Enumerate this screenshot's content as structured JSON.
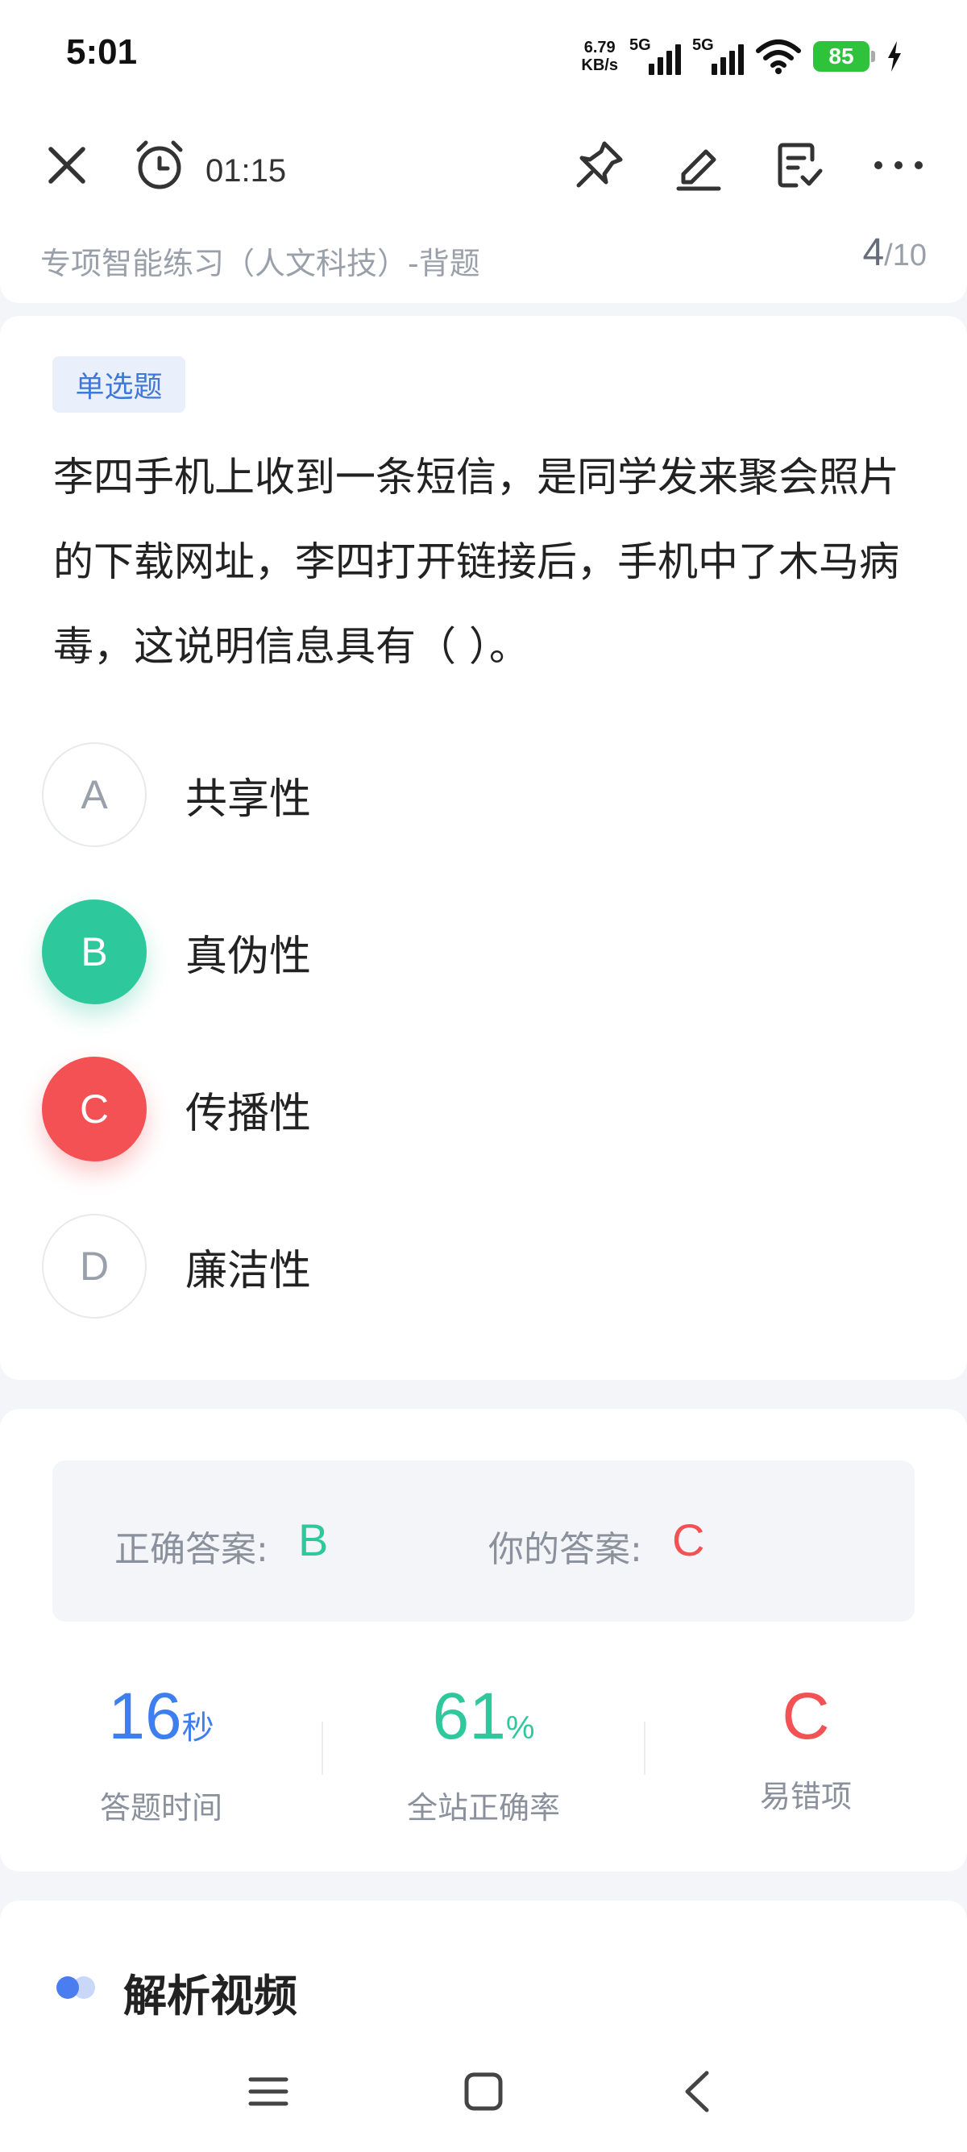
{
  "status_bar": {
    "time": "5:01",
    "net_speed_value": "6.79",
    "net_speed_unit": "KB/s",
    "signal1_label": "5G",
    "signal2_label": "5G",
    "battery": "85"
  },
  "toolbar": {
    "timer": "01:15",
    "subtitle": "专项智能练习（人文科技）-背题",
    "progress_current": "4",
    "progress_total": "/10"
  },
  "question": {
    "type": "单选题",
    "text": "李四手机上收到一条短信，是同学发来聚会照片的下载网址，李四打开链接后，手机中了木马病毒，这说明信息具有（    ）。",
    "options": [
      {
        "letter": "A",
        "text": "共享性",
        "state": "normal"
      },
      {
        "letter": "B",
        "text": "真伪性",
        "state": "correct"
      },
      {
        "letter": "C",
        "text": "传播性",
        "state": "wrong"
      },
      {
        "letter": "D",
        "text": "廉洁性",
        "state": "normal"
      }
    ]
  },
  "answer": {
    "correct_label": "正确答案:",
    "correct_value": "B",
    "yours_label": "你的答案:",
    "yours_value": "C"
  },
  "stats": {
    "time_value": "16",
    "time_unit": "秒",
    "time_label": "答题时间",
    "accuracy_value": "61",
    "accuracy_unit": "%",
    "accuracy_label": "全站正确率",
    "mistake_value": "C",
    "mistake_label": "易错项"
  },
  "analysis": {
    "title": "解析视频"
  },
  "colors": {
    "correct": "#2ec89d",
    "wrong": "#f45154",
    "accent_blue": "#3d7ff0"
  }
}
